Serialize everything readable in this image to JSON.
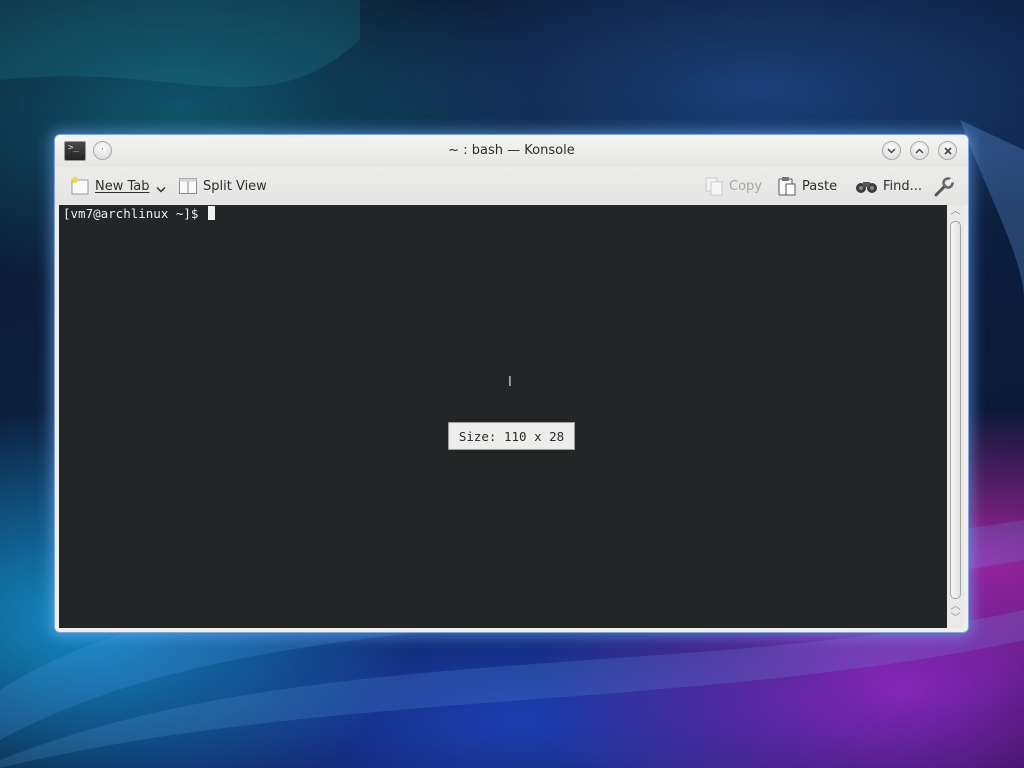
{
  "window": {
    "title": "~ : bash — Konsole",
    "buttons": [
      "minimize",
      "maximize",
      "close"
    ]
  },
  "toolbar": {
    "new_tab_label": "New Tab",
    "split_view_label": "Split View",
    "copy_label": "Copy",
    "paste_label": "Paste",
    "find_label": "Find..."
  },
  "terminal": {
    "prompt": "[vm7@archlinux ~]$ ",
    "size_tooltip": "Size: 110 x 28"
  },
  "colors": {
    "terminal_bg": "#232627",
    "terminal_fg": "#eff0f1"
  }
}
